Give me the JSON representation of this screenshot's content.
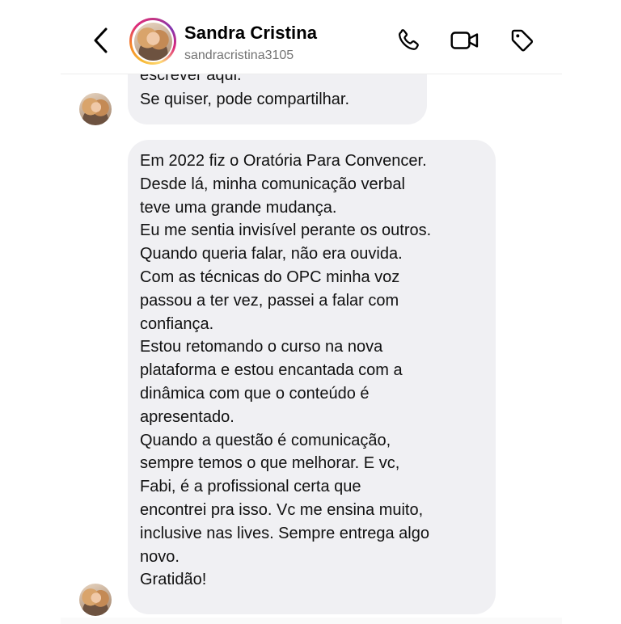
{
  "header": {
    "back_icon": "chevron-left-icon",
    "contact_name": "Sandra Cristina",
    "contact_handle": "sandracristina3105",
    "actions": [
      "phone-icon",
      "video-camera-icon",
      "tag-icon"
    ]
  },
  "messages": {
    "first": {
      "lines": [
        "escrever aqui.",
        "Se quiser, pode compartilhar."
      ]
    },
    "second": {
      "paragraphs": [
        [
          "Em 2022 fiz o Oratória Para Convencer.",
          "Desde lá, minha comunicação verbal",
          "teve uma grande mudança."
        ],
        [
          "Eu me sentia invisível perante os outros.",
          "Quando queria falar, não era ouvida."
        ],
        [
          "Com as técnicas do OPC minha voz",
          "passou a ter vez, passei a falar com",
          "confiança."
        ],
        [
          "Estou retomando o curso na nova",
          "plataforma e estou encantada com a",
          "dinâmica com que o conteúdo é",
          "apresentado."
        ],
        [
          "Quando a questão é comunicação,",
          "sempre temos o que melhorar. E vc,",
          "Fabi, é a profissional certa que",
          "encontrei pra isso. Vc me ensina muito,",
          "inclusive nas lives. Sempre entrega algo",
          "novo."
        ],
        [
          "Gratidão!"
        ]
      ]
    }
  },
  "colors": {
    "bubble": "#f0f0f3",
    "text": "#111111",
    "handle": "#737373"
  }
}
